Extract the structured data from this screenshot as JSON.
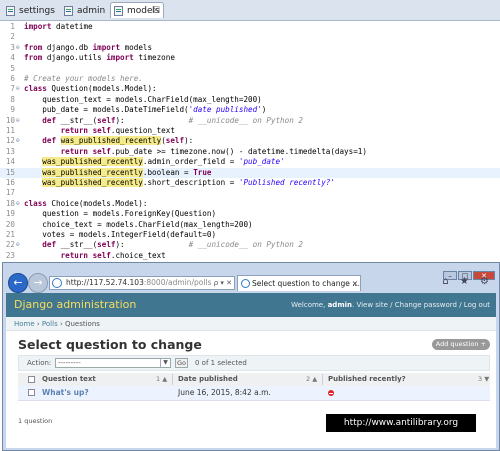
{
  "editor": {
    "tabs": [
      {
        "label": "settings",
        "active": false
      },
      {
        "label": "admin",
        "active": false
      },
      {
        "label": "models",
        "active": true
      }
    ],
    "close_glyph": "☒"
  },
  "browser": {
    "url_host": "http://117.52.74.103",
    "url_rest": ":8000/admin/polls",
    "url_controls": "ρ ▾ ✕",
    "tab_title": "Select question to change ...",
    "tab_close": "×",
    "toolbar_icons": "⌂ ★ ⚙",
    "caption_buttons": [
      "–",
      "□",
      "✕"
    ],
    "back_glyph": "←",
    "forward_glyph": "→"
  },
  "admin": {
    "site_title": "Django administration",
    "welcome": "Welcome,",
    "username": "admin",
    "links": ". View site / Change password / Log out",
    "breadcrumb_home": "Home",
    "breadcrumb_sep": " › ",
    "breadcrumb_app": "Polls",
    "breadcrumb_current": "Questions",
    "page_title": "Select question to change",
    "add_button": "Add question +",
    "action_label": "Action:",
    "action_value": "---------",
    "go_label": "Go",
    "selected_count": "0 of 1 selected",
    "columns": [
      {
        "label": "Question text",
        "sort": "1 ▲"
      },
      {
        "label": "Date published",
        "sort": "2 ▲"
      },
      {
        "label": "Published recently?",
        "sort": "3 ▼"
      }
    ],
    "rows": [
      {
        "question_text": "What's up?",
        "date_published": "June 16, 2015, 8:42 a.m.",
        "published_recently": false
      }
    ],
    "result_count": "1 question"
  },
  "watermark": "http://www.antilibrary.org"
}
